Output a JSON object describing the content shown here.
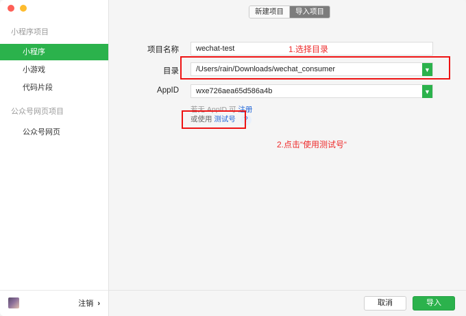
{
  "sidebar": {
    "section_miniprogram": "小程序项目",
    "items_mp": [
      "小程序",
      "小游戏",
      "代码片段"
    ],
    "section_official": "公众号网页项目",
    "items_official": [
      "公众号网页"
    ],
    "logout_label": "注销",
    "logout_chevron": "›"
  },
  "tabs": {
    "new": "新建项目",
    "import": "导入项目"
  },
  "form": {
    "name_label": "项目名称",
    "name_value": "wechat-test",
    "dir_label": "目录",
    "dir_value": "/Users/rain/Downloads/wechat_consumer",
    "appid_label": "AppID",
    "appid_value": "wxe726aea65d586a4b",
    "hint_no_appid": "若无 AppID 可",
    "hint_register": "注册",
    "hint_or_use": "或使用",
    "hint_test_account": "测试号",
    "hint_q": "?"
  },
  "annotations": {
    "step1": "1.选择目录",
    "step2": "2.点击“使用测试号“"
  },
  "buttons": {
    "cancel": "取消",
    "import": "导入"
  },
  "colors": {
    "accent": "#2bb24c",
    "annotation": "#ee2a2a",
    "link": "#2266d8"
  }
}
